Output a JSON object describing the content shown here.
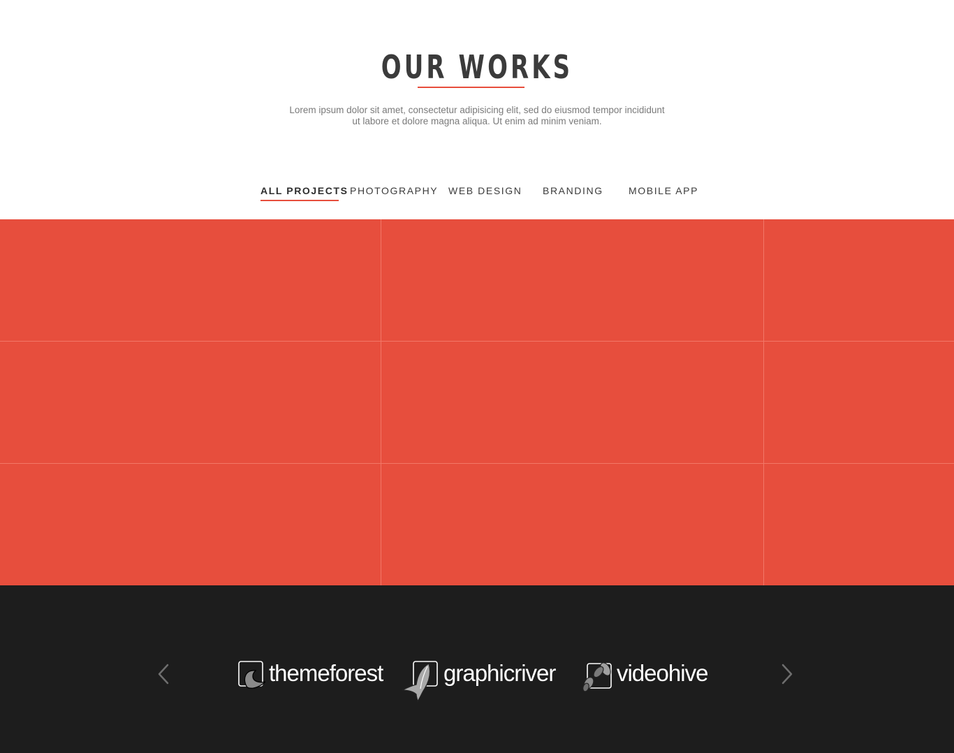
{
  "header": {
    "title": "OUR WORKS",
    "description_line1": "Lorem ipsum dolor sit amet, consectetur adipisicing elit, sed do eiusmod tempor incididunt",
    "description_line2": "ut labore et dolore magna aliqua. Ut enim ad minim veniam."
  },
  "filters": [
    {
      "label": "ALL PROJECTS",
      "active": true
    },
    {
      "label": "PHOTOGRAPHY",
      "active": false
    },
    {
      "label": "WEB DESIGN",
      "active": false
    },
    {
      "label": "BRANDING",
      "active": false
    },
    {
      "label": "MOBILE APP",
      "active": false
    }
  ],
  "colors": {
    "accent": "#e74e3d",
    "dark_bg": "#1d1d1d",
    "title_text": "#3b3b3b"
  },
  "clients": {
    "prev_icon": "chevron-left-icon",
    "next_icon": "chevron-right-icon",
    "logos": [
      {
        "name": "themeforest",
        "icon": "leaf-icon"
      },
      {
        "name": "graphicriver",
        "icon": "fish-icon"
      },
      {
        "name": "videohive",
        "icon": "bees-icon"
      }
    ]
  }
}
